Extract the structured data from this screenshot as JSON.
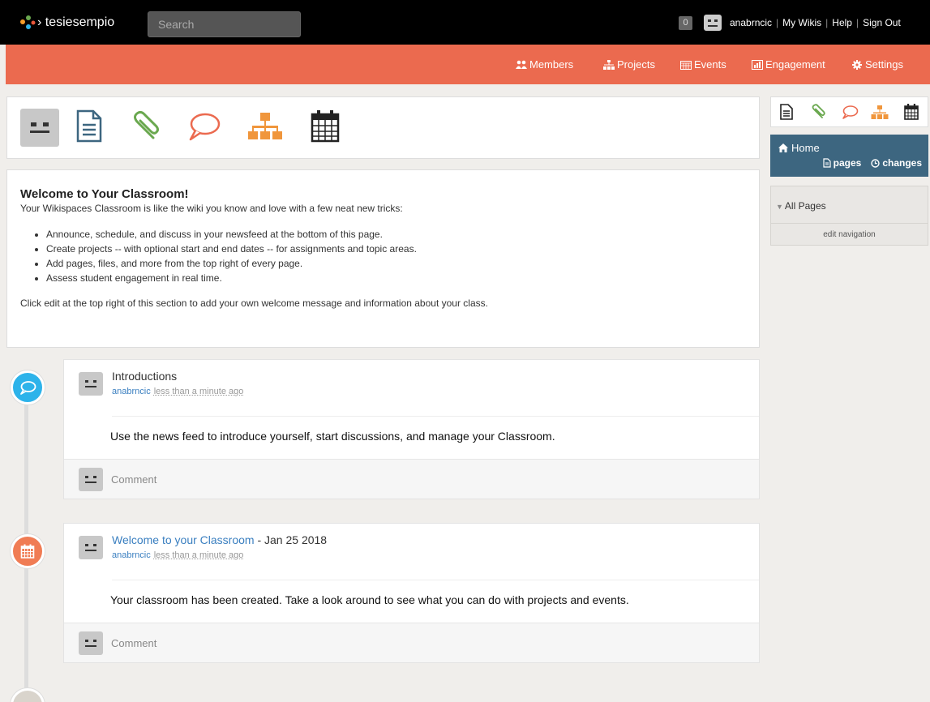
{
  "topbar": {
    "brand": "› tesiesempio",
    "search_placeholder": "Search",
    "notification_count": "0",
    "username": "anabrncic",
    "links": [
      "My Wikis",
      "Help",
      "Sign Out"
    ]
  },
  "nav": {
    "members": "Members",
    "projects": "Projects",
    "events": "Events",
    "engagement": "Engagement",
    "settings": "Settings"
  },
  "welcome": {
    "title": "Welcome to Your Classroom!",
    "subtitle": "Your Wikispaces Classroom is like the wiki you know and love with a few neat new tricks:",
    "bullets": [
      "Announce, schedule, and discuss in your newsfeed at the bottom of this page.",
      "Create projects -- with optional start and end dates -- for assignments and topic areas.",
      "Add pages, files, and more from the top right of every page.",
      "Assess student engagement in real time."
    ],
    "footer": "Click edit at the top right of this section to add your own welcome message and information about your class."
  },
  "feed": [
    {
      "title": "Introductions",
      "title_link": "",
      "title_suffix": "",
      "user": "anabrncic",
      "time": "less than a minute ago",
      "body": "Use the news feed to introduce yourself, start discussions, and manage your Classroom.",
      "comment_placeholder": "Comment"
    },
    {
      "title": "",
      "title_link": "Welcome to your Classroom",
      "title_suffix": " - Jan 25 2018",
      "user": "anabrncic",
      "time": "less than a minute ago",
      "body": "Your classroom has been created. Take a look around to see what you can do with projects and events.",
      "comment_placeholder": "Comment"
    }
  ],
  "sidebar": {
    "home": "Home",
    "pages_link": "pages",
    "changes_link": "changes",
    "all_pages": "All Pages",
    "edit_navigation": "edit navigation"
  },
  "colors": {
    "topbar": "#000000",
    "nav": "#eb6a4f",
    "home_box": "#3d6680",
    "discussion": "#2db3ea",
    "event": "#f07c54",
    "project": "#f0963c",
    "file": "#6aa84f",
    "page": "#3d6680",
    "link": "#3a7fc0"
  },
  "icons": {
    "tools": [
      "avatar-icon",
      "page-icon",
      "paperclip-icon",
      "speech-bubble-icon",
      "project-tree-icon",
      "calendar-icon"
    ]
  }
}
